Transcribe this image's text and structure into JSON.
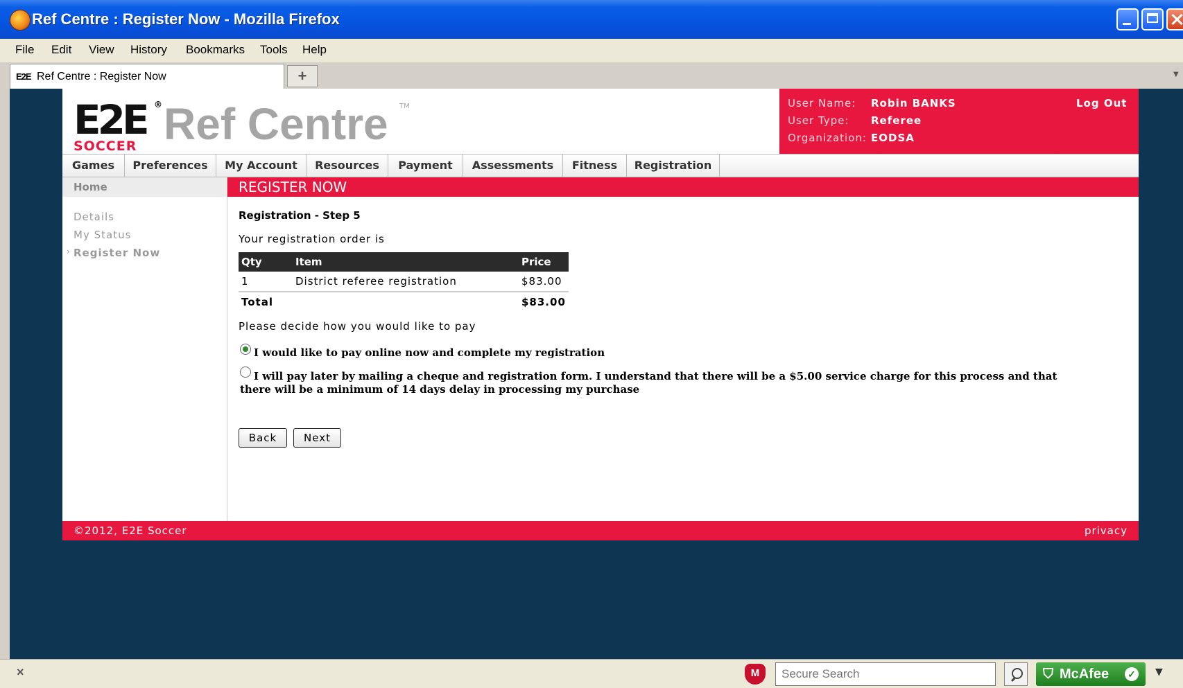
{
  "window": {
    "title": "Ref Centre : Register Now - Mozilla Firefox"
  },
  "menu": [
    "File",
    "Edit",
    "View",
    "History",
    "Bookmarks",
    "Tools",
    "Help"
  ],
  "tab": {
    "favicon": "E2E",
    "label": "Ref Centre : Register Now",
    "new_tab_symbol": "+"
  },
  "header": {
    "logo_main": "E2E",
    "logo_sub": "SOCCER",
    "logo_reg": "®",
    "brand": "Ref Centre",
    "brand_tm": "TM",
    "user_name_label": "User Name:",
    "user_name": "Robin BANKS",
    "user_type_label": "User Type:",
    "user_type": "Referee",
    "org_label": "Organization:",
    "org": "EODSA",
    "logout": "Log Out"
  },
  "nav": [
    "Games",
    "Preferences",
    "My Account",
    "Resources",
    "Payment",
    "Assessments",
    "Fitness",
    "Registration"
  ],
  "sidebar": {
    "home": "Home",
    "links": [
      "Details",
      "My Status",
      "Register Now"
    ],
    "active_marker": "›"
  },
  "main": {
    "banner": "REGISTER NOW",
    "step": "Registration - Step 5",
    "intro": "Your registration order is",
    "table": {
      "headers": [
        "Qty",
        "Item",
        "Price"
      ],
      "rows": [
        [
          "1",
          "District referee registration",
          "$83.00"
        ]
      ],
      "total_label": "Total",
      "total_value": "$83.00"
    },
    "decide": "Please decide how you would like to pay",
    "option_online": "I would like to pay online now and complete my registration",
    "option_mail": "I will pay later by mailing a cheque and registration form. I understand that there will be a $5.00 service charge for this process and that there will be a minimum of 14 days delay in processing my purchase",
    "selected_option": "online",
    "back": "Back",
    "next": "Next"
  },
  "footer": {
    "copyright": "©2012, E2E Soccer",
    "privacy": "privacy"
  },
  "statusbar": {
    "close_symbol": "×",
    "search_placeholder": "Secure Search",
    "mcafee_label": "McAfee"
  },
  "colors": {
    "brand_red": "#e8173f",
    "page_bg": "#0e3653",
    "nav_bg": "#ececec"
  },
  "icons": [
    "firefox-icon",
    "minimize-icon",
    "maximize-icon",
    "close-icon",
    "plus-icon",
    "mcafee-shield-icon",
    "search-icon",
    "check-icon",
    "chevron-down-icon"
  ]
}
